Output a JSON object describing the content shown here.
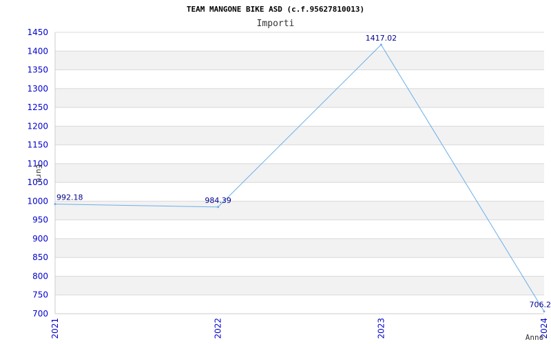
{
  "chart_data": {
    "type": "line",
    "title": "TEAM MANGONE BIKE ASD (c.f.95627810013)",
    "subtitle": "Importi",
    "xlabel": "Anno",
    "ylabel": "Euro",
    "categories": [
      "2021",
      "2022",
      "2023",
      "2024"
    ],
    "series": [
      {
        "values": [
          992.18,
          984.39,
          1417.02,
          706.2
        ],
        "labels": [
          "992.18",
          "984.39",
          "1417.02",
          "706.2"
        ]
      }
    ],
    "ylim": [
      700,
      1450
    ],
    "ytick_step": 50,
    "grid": true,
    "colors": {
      "line": "#6aaee8",
      "tick_text": "#0000cc",
      "data_label": "#00008b",
      "band": "#f2f2f2",
      "grid": "#d8d8d8",
      "axis": "#cccccc"
    }
  }
}
